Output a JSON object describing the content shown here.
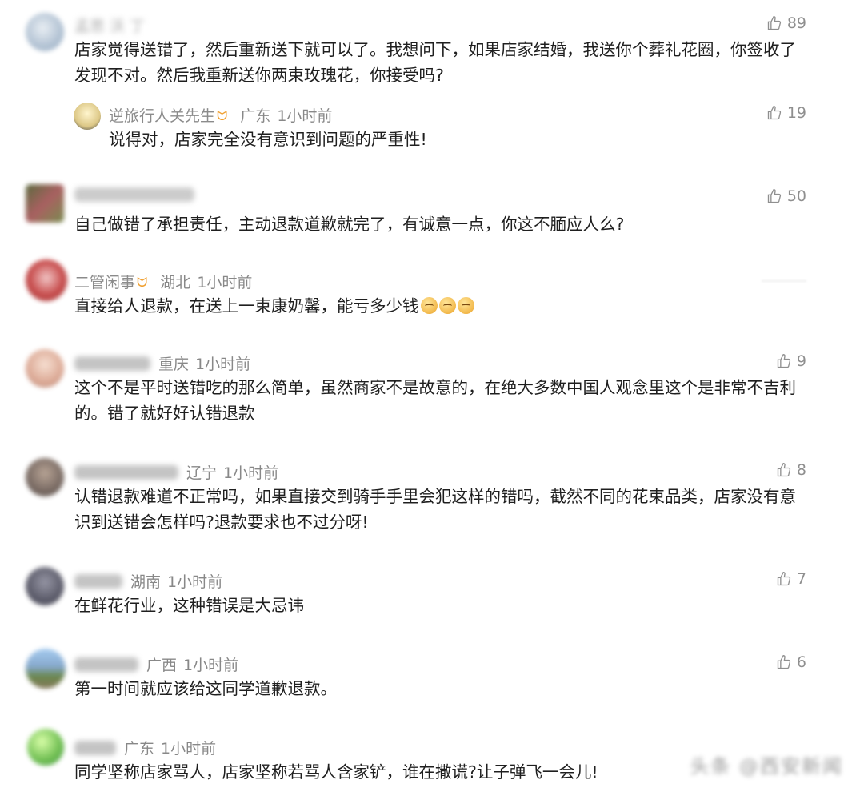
{
  "comments": [
    {
      "name": "孟思 沃 丁",
      "location": "",
      "time": "",
      "text": "店家觉得送错了，然后重新送下就可以了。我想问下，如果店家结婚，我送你个葬礼花圈，你签收了发现不对。然后我重新送你两束玫瑰花，你接受吗?",
      "likes": "89",
      "avatar_color": "#9fb3c8"
    },
    {
      "name": "逆旅行人关先生",
      "location": "广东",
      "time": "1小时前",
      "text": "说得对，店家完全没有意识到问题的严重性!",
      "likes": "19",
      "avatar_color": "#d9c27a",
      "reply": true
    },
    {
      "name": "",
      "location": "",
      "time": "",
      "text": "自己做错了承担责任，主动退款道歉就完了，有诚意一点，你这不腼应人么?",
      "likes": "50",
      "avatar_color": "#6b7f3d"
    },
    {
      "name": "二管闲事",
      "location": "湖北",
      "time": "1小时前",
      "text": "直接给人退款，在送上一束康奶馨，能亏多少钱",
      "likes": "",
      "avatar_color": "#c23a3a"
    },
    {
      "name": "",
      "location": "重庆",
      "time": "1小时前",
      "text": "这个不是平时送错吃的那么简单，虽然商家不是故意的，在绝大多数中国人观念里这个是非常不吉利的。错了就好好认错退款",
      "likes": "9",
      "avatar_color": "#d8a08a"
    },
    {
      "name": "",
      "location": "辽宁",
      "time": "1小时前",
      "text": "认错退款难道不正常吗，如果直接交到骑手手里会犯这样的错吗，截然不同的花束品类，店家没有意识到送错会怎样吗?退款要求也不过分呀!",
      "likes": "8",
      "avatar_color": "#6a5a52"
    },
    {
      "name": "",
      "location": "湖南",
      "time": "1小时前",
      "text": "在鲜花行业，这种错误是大忌讳",
      "likes": "7",
      "avatar_color": "#4a4a5a"
    },
    {
      "name": "",
      "location": "广西",
      "time": "1小时前",
      "text": "第一时间就应该给这同学道歉退款。",
      "likes": "6",
      "avatar_color": "#7aa0c8"
    },
    {
      "name": "",
      "location": "广东",
      "time": "1小时前",
      "text": "同学坚称店家骂人，店家坚称若骂人含家铲，谁在撒谎?让子弹飞一会儿!",
      "likes": "",
      "avatar_color": "#66bb44"
    }
  ],
  "watermark": "头条 @西安新闻"
}
